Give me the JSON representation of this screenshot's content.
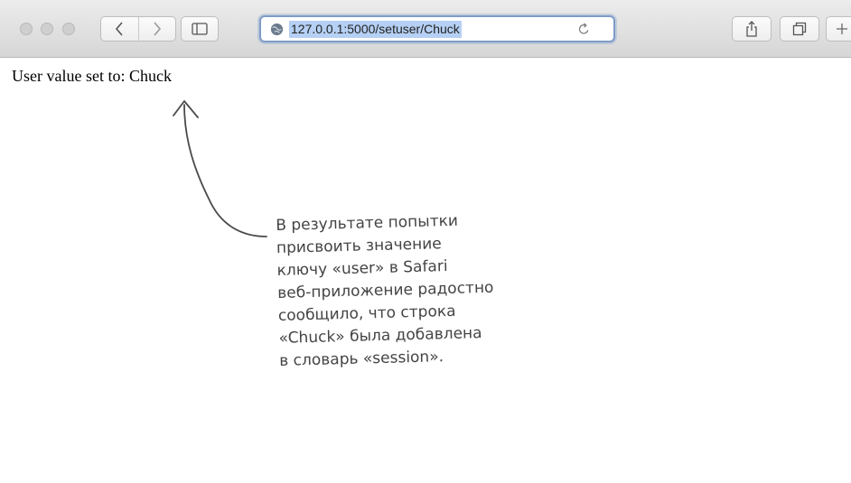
{
  "browser": {
    "url": "127.0.0.1:5000/setuser/Chuck",
    "icons": {
      "back": "chevron-left-icon",
      "forward": "chevron-right-icon",
      "sidebar": "sidebar-icon",
      "site": "globe-icon",
      "reload": "reload-icon",
      "share": "share-icon",
      "tabs": "tabs-icon",
      "new_tab": "plus-icon"
    }
  },
  "page": {
    "message": "User value set to: Chuck"
  },
  "annotation": {
    "lines": [
      "В результате попытки",
      "присвоить значение",
      "ключу «user» в Safari",
      "веб-приложение радостно",
      "сообщило, что строка",
      "«Chuck» была добавлена",
      "в словарь «session»."
    ],
    "color": "#444444"
  },
  "colors": {
    "address_focus": "#7f9cc7",
    "url_selection": "#b5d0f4"
  }
}
